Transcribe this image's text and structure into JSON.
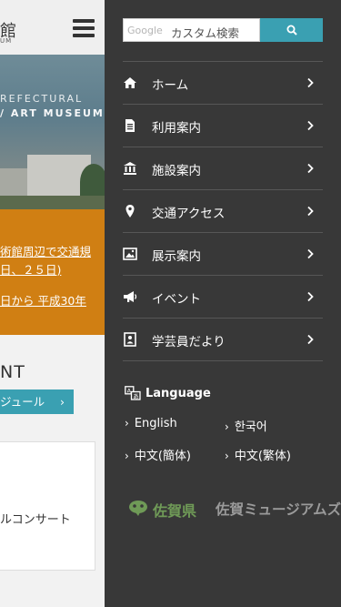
{
  "background_page": {
    "logo_main": "館",
    "logo_sub": "UM",
    "hero_line1": "REFECTURAL",
    "hero_line2": "/ ART MUSEUM",
    "notice_lines": [
      "術館周辺で交通規",
      "日、２５日)",
      "日から 平成30年"
    ],
    "event_heading": "NT",
    "schedule_button": "ジュール",
    "event_card_text": "ルコンサート"
  },
  "drawer": {
    "search": {
      "brand": "Google",
      "placeholder": "カスタム検索"
    },
    "menu_items": [
      {
        "label": "ホーム",
        "icon": "home-icon"
      },
      {
        "label": "利用案内",
        "icon": "document-icon"
      },
      {
        "label": "施設案内",
        "icon": "building-icon"
      },
      {
        "label": "交通アクセス",
        "icon": "map-pin-icon"
      },
      {
        "label": "展示案内",
        "icon": "image-icon"
      },
      {
        "label": "イベント",
        "icon": "megaphone-icon"
      },
      {
        "label": "学芸員だより",
        "icon": "notebook-icon"
      }
    ],
    "language": {
      "title": "Language",
      "links": [
        "English",
        "한국어",
        "中文(簡体)",
        "中文(繁体)"
      ]
    },
    "footer": {
      "prefecture_logo": "佐賀県",
      "museums_logo": "佐賀ミュージアムズ"
    }
  },
  "colors": {
    "drawer_bg": "#383838",
    "accent": "#3aa0b2",
    "notice_orange": "#d07f13",
    "saga_green": "#6f9a57"
  }
}
